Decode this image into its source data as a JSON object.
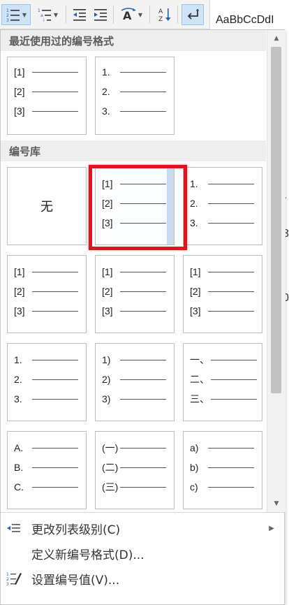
{
  "toolbar": {
    "buttons": [
      {
        "name": "multilevel-list",
        "icon": "numbering-icon",
        "active": true
      },
      {
        "name": "multilevel-list-2",
        "icon": "multilevel-list-icon"
      },
      {
        "name": "decrease-indent",
        "icon": "decrease-indent-icon"
      },
      {
        "name": "increase-indent",
        "icon": "increase-indent-icon"
      },
      {
        "name": "text-direction",
        "icon": "text-direction-icon"
      },
      {
        "name": "sort",
        "icon": "sort-icon"
      },
      {
        "name": "show-marks",
        "icon": "paragraph-marks-icon",
        "active": true
      }
    ]
  },
  "styles_pane": {
    "preview": "AaBbCcDdI",
    "fragments": [
      "r",
      "3",
      "0"
    ]
  },
  "sections": {
    "recent_title": "最近使用过的编号格式",
    "library_title": "编号库"
  },
  "recent_formats": [
    {
      "markers": [
        "[1]",
        "[2]",
        "[3]"
      ]
    },
    {
      "markers": [
        "1.",
        "2.",
        "3."
      ]
    }
  ],
  "library_formats": [
    {
      "label": "无",
      "none": true
    },
    {
      "markers": [
        "[1]",
        "[2]",
        "[3]"
      ],
      "selected": true
    },
    {
      "markers": [
        "1.",
        "2.",
        "3."
      ]
    },
    {
      "markers": [
        "[1]",
        "[2]",
        "[3]"
      ]
    },
    {
      "markers": [
        "[1]",
        "[2]",
        "[3]"
      ]
    },
    {
      "markers": [
        "[1]",
        "[2]",
        "[3]"
      ]
    },
    {
      "markers": [
        "1.",
        "2.",
        "3."
      ]
    },
    {
      "markers": [
        "1)",
        "2)",
        "3)"
      ]
    },
    {
      "markers": [
        "一、",
        "二、",
        "三、"
      ]
    },
    {
      "markers": [
        "A.",
        "B.",
        "C."
      ]
    },
    {
      "markers": [
        "(一)",
        "(二)",
        "(三)"
      ]
    },
    {
      "markers": [
        "a)",
        "b)",
        "c)"
      ]
    }
  ],
  "menu": [
    {
      "label": "更改列表级别(C)",
      "icon": "change-list-level-icon",
      "submenu": true
    },
    {
      "label": "定义新编号格式(D)...",
      "icon": ""
    },
    {
      "label": "设置编号值(V)...",
      "icon": "set-numbering-value-icon"
    }
  ],
  "colors": {
    "highlight_box": "#e0141e",
    "selected_fill": "#c7dcf2",
    "section_header_bg": "#eeeeee",
    "toolbar_active": "#cfe3f7"
  }
}
